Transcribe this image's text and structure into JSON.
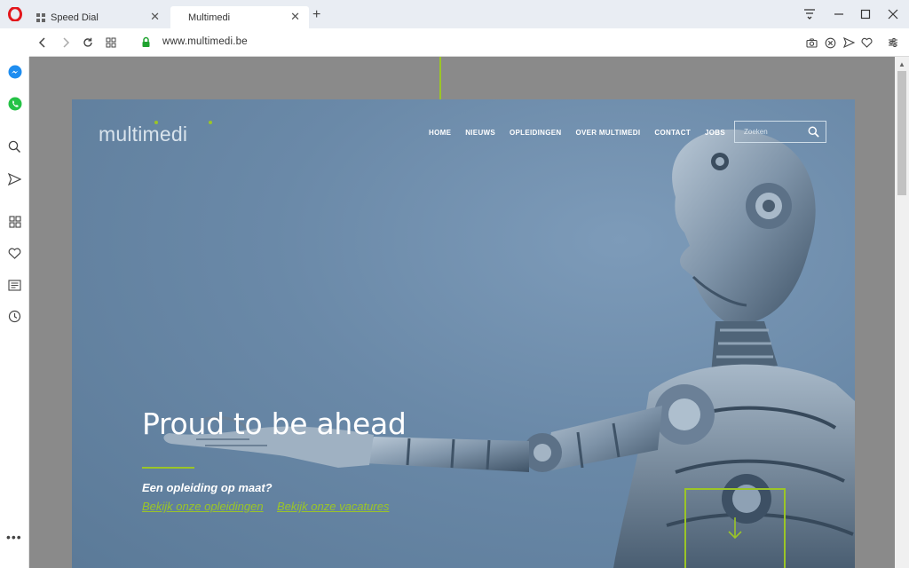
{
  "browser": {
    "tabs": [
      {
        "label": "Speed Dial"
      },
      {
        "label": "Multimedi"
      }
    ],
    "new_tab_label": "+",
    "address": "www.multimedi.be"
  },
  "site": {
    "logo": "multimedi",
    "nav": [
      {
        "label": "HOME"
      },
      {
        "label": "NIEUWS"
      },
      {
        "label": "OPLEIDINGEN"
      },
      {
        "label": "OVER MULTIMEDI"
      },
      {
        "label": "CONTACT"
      },
      {
        "label": "JOBS"
      }
    ],
    "search_placeholder": "Zoeken",
    "hero_title": "Proud to be ahead",
    "hero_subtitle": "Een opleiding op maat?",
    "link_trainings": "Bekijk onze opleidingen",
    "link_vacancies": "Bekijk onze vacatures"
  },
  "colors": {
    "accent": "#9bc527",
    "hero_bg": "#6a89a8",
    "opera_red": "#e3161b"
  },
  "icons": {
    "sidebar": [
      "messenger-icon",
      "whatsapp-icon",
      "search-icon",
      "send-icon",
      "speed-dial-icon",
      "heart-icon",
      "news-icon",
      "history-icon",
      "more-icon"
    ]
  }
}
